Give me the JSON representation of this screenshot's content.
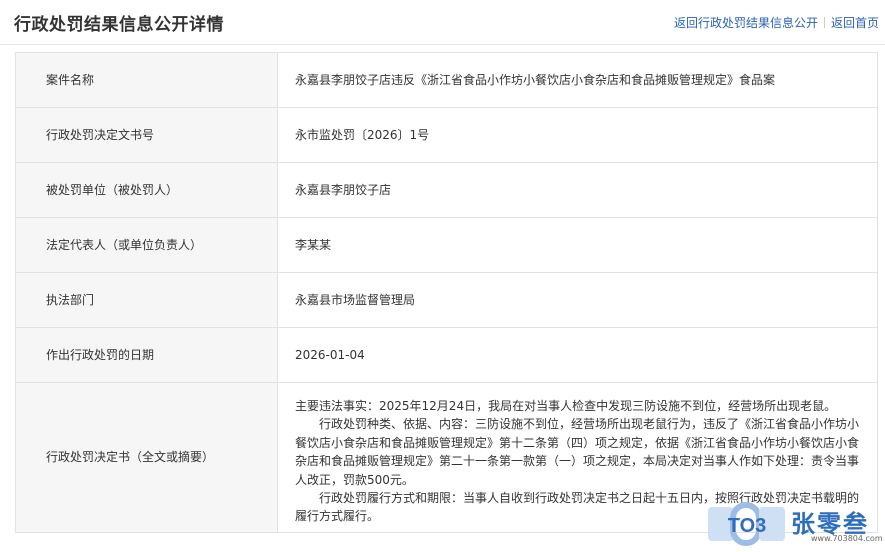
{
  "header": {
    "title": "行政处罚结果信息公开详情",
    "back_list_link": "返回行政处罚结果信息公开",
    "back_home_link": "返回首页"
  },
  "rows": [
    {
      "label": "案件名称",
      "value": "永嘉县李朋饺子店违反《浙江省食品小作坊小餐饮店小食杂店和食品摊贩管理规定》食品案"
    },
    {
      "label": "行政处罚决定文书号",
      "value": "永市监处罚〔2026〕1号"
    },
    {
      "label": "被处罚单位（被处罚人）",
      "value": "永嘉县李朋饺子店"
    },
    {
      "label": "法定代表人（或单位负责人）",
      "value": "李某某"
    },
    {
      "label": "执法部门",
      "value": "永嘉县市场监督管理局"
    },
    {
      "label": "作出行政处罚的日期",
      "value": "2026-01-04"
    }
  ],
  "decision": {
    "label": "行政处罚决定书（全文或摘要）",
    "facts": "主要违法事实：2025年12月24日，我局在对当事人检查中发现三防设施不到位，经营场所出现老鼠。",
    "basis": "行政处罚种类、依据、内容：三防设施不到位，经营场所出现老鼠行为，违反了《浙江省食品小作坊小餐饮店小食杂店和食品摊贩管理规定》第十二条第（四）项之规定，依据《浙江省食品小作坊小餐饮店小食杂店和食品摊贩管理规定》第二十一条第一款第（一）项之规定，本局决定对当事人作如下处理：责令当事人改正，罚款500元。",
    "execution": "行政处罚履行方式和期限：当事人自收到行政处罚决定书之日起十五日内，按照行政处罚决定书载明的履行方式履行。"
  },
  "watermark": {
    "logo_text": "TO3",
    "brand": "张零叁",
    "url": "www.703804.com"
  },
  "colors": {
    "link": "#2a63b8",
    "label_bg": "#f6f6f6",
    "border": "#e2e2e2",
    "watermark": "#2f6dbf"
  }
}
